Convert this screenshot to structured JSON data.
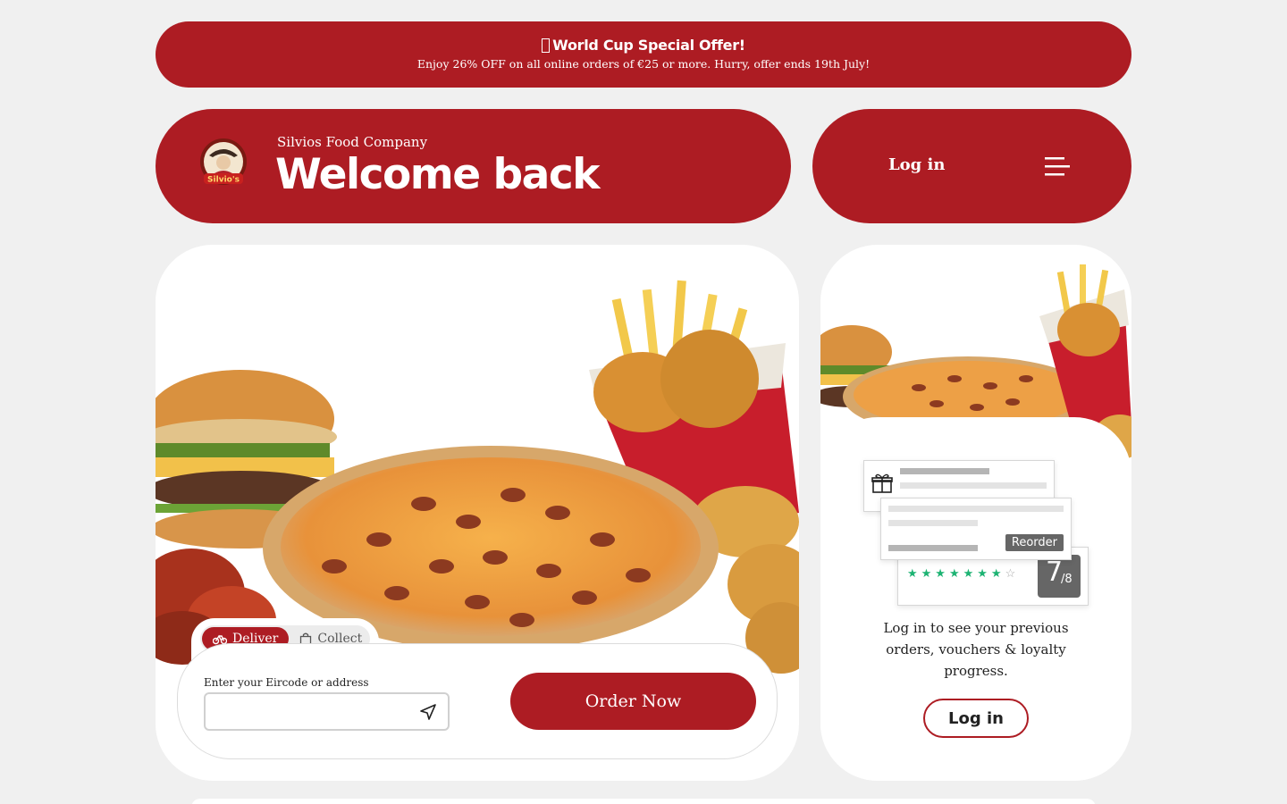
{
  "promo": {
    "title": "World Cup Special Offer!",
    "text": "Enjoy 26% OFF on all online orders of €25 or more. Hurry, offer ends 19th July!"
  },
  "header": {
    "company": "Silvios Food Company",
    "greeting": "Welcome back",
    "logo_text": "Silvio's"
  },
  "nav": {
    "login_label": "Log in",
    "menu_icon": "hamburger-menu-icon"
  },
  "order": {
    "tabs": [
      {
        "label": "Deliver",
        "icon": "bike-icon",
        "active": true
      },
      {
        "label": "Collect",
        "icon": "bag-icon",
        "active": false
      }
    ],
    "address_label": "Enter your Eircode or address",
    "address_value": "",
    "address_placeholder": "",
    "order_button": "Order Now"
  },
  "loyalty": {
    "reorder_label": "Reorder",
    "stars_filled": 7,
    "stars_total": 8,
    "score_value": "7",
    "score_total": "/8",
    "message": "Log in to see your previous orders, vouchers & loyalty progress.",
    "login_button": "Log in",
    "gift_icon": "gift-icon"
  },
  "colors": {
    "brand_red": "#ad1c23",
    "background": "#f0f0f0",
    "star_green": "#1db373"
  }
}
